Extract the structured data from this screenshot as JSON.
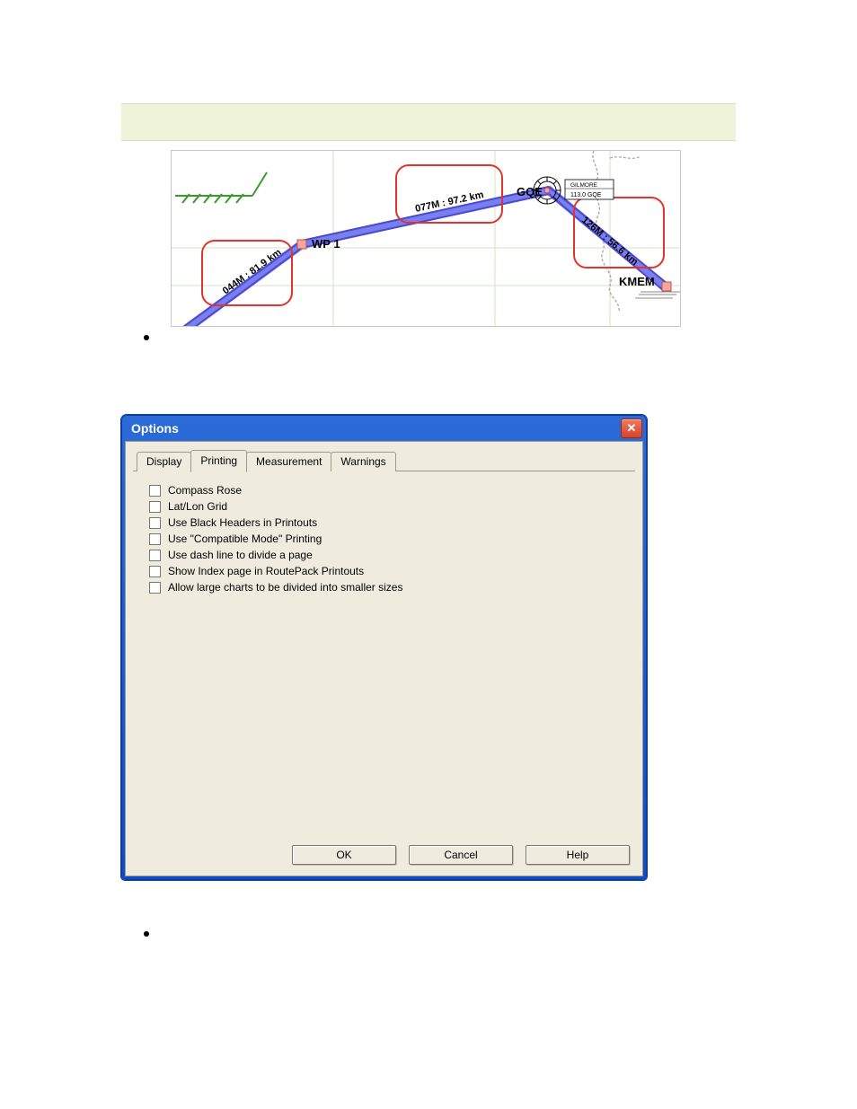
{
  "map": {
    "waypoints": {
      "wp1": "WP 1",
      "gqe": "GQE",
      "kmem": "KMEM",
      "gqe_navbox_top": "GILMORE",
      "gqe_navbox_bottom": "113.0 GQE"
    },
    "legs": {
      "leg1": "044M : 81.9 km",
      "leg2": "077M : 97.2 km",
      "leg3": "126M : 56.6 km"
    }
  },
  "dialog": {
    "title": "Options",
    "tabs": {
      "display": "Display",
      "printing": "Printing",
      "measurement": "Measurement",
      "warnings": "Warnings"
    },
    "options": {
      "compass_rose": "Compass Rose",
      "latlon_grid": "Lat/Lon Grid",
      "black_headers": "Use Black Headers in Printouts",
      "compatible_mode": "Use \"Compatible Mode\" Printing",
      "dash_line": "Use dash line to divide a page",
      "index_page": "Show Index page in RoutePack Printouts",
      "divide_large": "Allow large charts to be divided into smaller sizes"
    },
    "buttons": {
      "ok": "OK",
      "cancel": "Cancel",
      "help": "Help"
    }
  }
}
